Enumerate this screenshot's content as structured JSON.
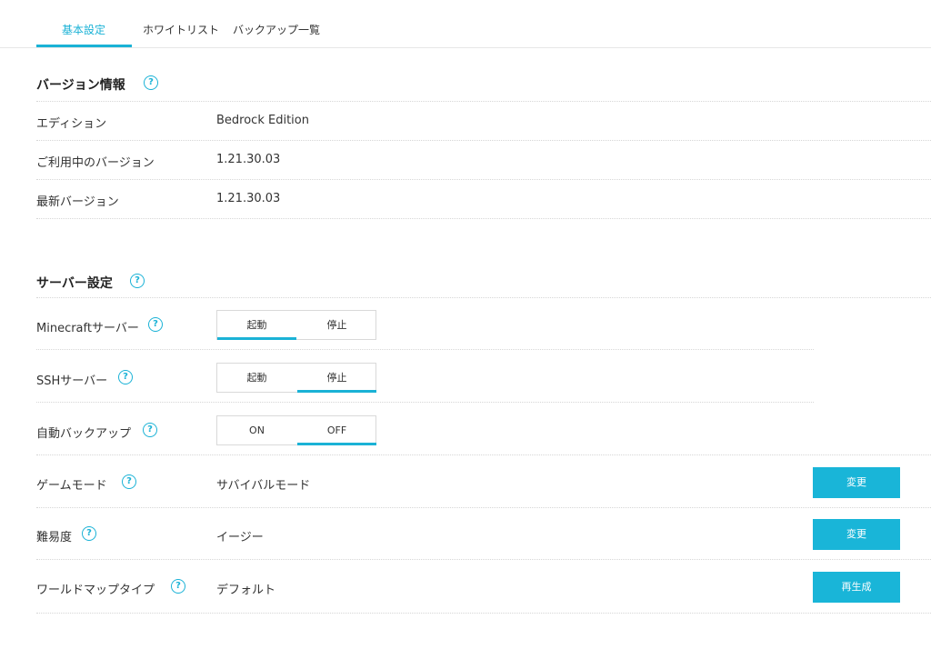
{
  "tabs": [
    "基本設定",
    "ホワイトリスト",
    "バックアップ一覧"
  ],
  "help_glyph": "?",
  "version_section": {
    "title": "バージョン情報",
    "rows": [
      {
        "label": "エディション",
        "value": "Bedrock Edition"
      },
      {
        "label": "ご利用中のバージョン",
        "value": "1.21.30.03"
      },
      {
        "label": "最新バージョン",
        "value": "1.21.30.03"
      }
    ]
  },
  "server_section": {
    "title": "サーバー設定",
    "toggles": [
      {
        "label": "Minecraftサーバー",
        "left": "起動",
        "right": "停止",
        "selected": "left"
      },
      {
        "label": "SSHサーバー",
        "left": "起動",
        "right": "停止",
        "selected": "right"
      },
      {
        "label": "自動バックアップ",
        "left": "ON",
        "right": "OFF",
        "selected": "right"
      }
    ],
    "settings": [
      {
        "label": "ゲームモード",
        "value": "サバイバルモード",
        "button": "変更"
      },
      {
        "label": "難易度",
        "value": "イージー",
        "button": "変更"
      },
      {
        "label": "ワールドマップタイプ",
        "value": "デフォルト",
        "button": "再生成"
      }
    ]
  },
  "colors": {
    "accent": "#1ab2d6",
    "button": "#19b5d8"
  }
}
